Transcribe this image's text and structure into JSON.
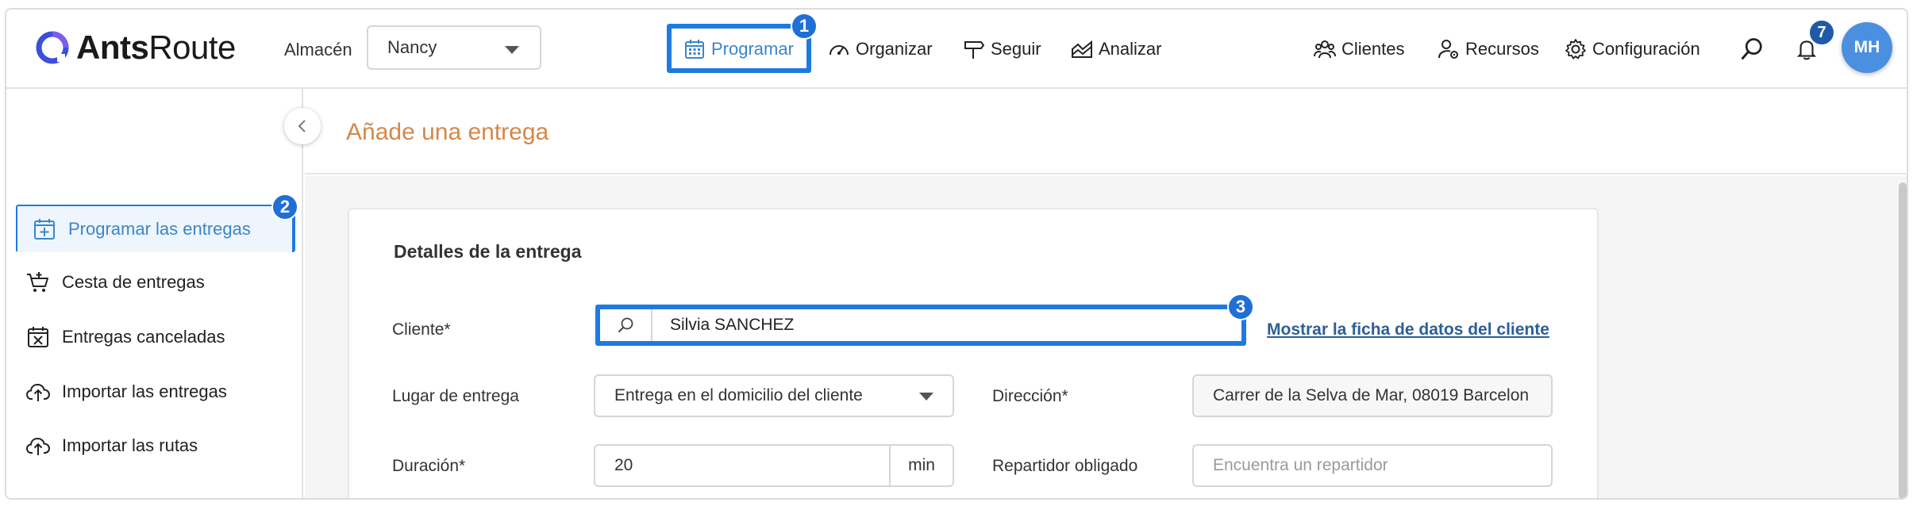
{
  "header": {
    "logo": {
      "brand_bold": "Ants",
      "brand_regular": "Route"
    },
    "warehouse": {
      "label": "Almacén",
      "selected": "Nancy"
    },
    "nav": {
      "programar": "Programar",
      "organizar": "Organizar",
      "seguir": "Seguir",
      "analizar": "Analizar",
      "clientes": "Clientes",
      "recursos": "Recursos",
      "configuracion": "Configuración"
    },
    "notifications_count": "7",
    "avatar_initials": "MH"
  },
  "steps": {
    "one": "1",
    "two": "2",
    "three": "3"
  },
  "sidebar": {
    "items": [
      {
        "label": "Programar las entregas",
        "icon": "calendar-plus-icon"
      },
      {
        "label": "Cesta de entregas",
        "icon": "basket-icon"
      },
      {
        "label": "Entregas canceladas",
        "icon": "calendar-x-icon"
      },
      {
        "label": "Importar las entregas",
        "icon": "cloud-upload-icon"
      },
      {
        "label": "Importar las rutas",
        "icon": "cloud-upload-icon"
      }
    ]
  },
  "page": {
    "title": "Añade una entrega"
  },
  "form": {
    "section_title": "Detalles de la entrega",
    "cliente": {
      "label": "Cliente*",
      "value": "Silvia SANCHEZ",
      "link": "Mostrar la ficha de datos del cliente"
    },
    "lugar": {
      "label": "Lugar de entrega",
      "value": "Entrega en el domicilio del cliente"
    },
    "direccion": {
      "label": "Dirección*",
      "value": "Carrer de la Selva de Mar, 08019 Barcelon"
    },
    "duracion": {
      "label": "Duración*",
      "value": "20",
      "unit": "min"
    },
    "repartidor": {
      "label": "Repartidor obligado",
      "placeholder": "Encuentra un repartidor"
    }
  },
  "colors": {
    "accent": "#3a86c8",
    "highlight": "#1f7ae0",
    "title": "#d3884a",
    "link": "#2c5f98",
    "avatar": "#4b8fe0"
  }
}
